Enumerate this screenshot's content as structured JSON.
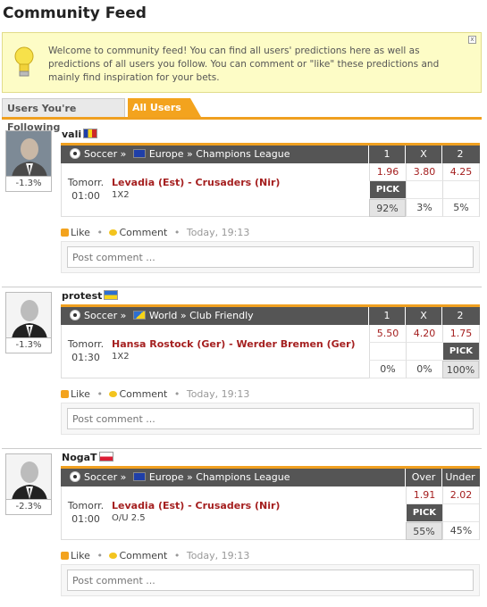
{
  "page": {
    "title": "Community Feed"
  },
  "notice": {
    "text": "Welcome to community feed! You can find all users' predictions here as well as predictions of all users you follow. You can comment or \"like\" these predictions and mainly find inspiration for your bets.",
    "close": "x"
  },
  "tabs": [
    {
      "label": "Users You're Following",
      "active": false
    },
    {
      "label": "All Users",
      "active": true
    }
  ],
  "posts": [
    {
      "user": "vali",
      "flag": "romania",
      "pct": "-1.3%",
      "sport": "Soccer",
      "sep1": "»",
      "region": "Europe",
      "sep2": "»",
      "league": "Champions League",
      "cols": [
        "1",
        "X",
        "2"
      ],
      "time_day": "Tomorr.",
      "time_hour": "01:00",
      "match": "Levadia (Est) - Crusaders (Nir)",
      "market": "1X2",
      "odds": [
        "1.96",
        "3.80",
        "4.25"
      ],
      "pick_index": 0,
      "pick_label": "PICK",
      "shares": [
        "92%",
        "3%",
        "5%"
      ],
      "like": "Like",
      "comment": "Comment",
      "timestamp": "Today, 19:13",
      "placeholder": "Post comment ..."
    },
    {
      "user": "protest",
      "flag": "ukraine",
      "pct": "-1.3%",
      "sport": "Soccer",
      "sep1": "»",
      "region": "World",
      "sep2": "»",
      "league": "Club Friendly",
      "cols": [
        "1",
        "X",
        "2"
      ],
      "time_day": "Tomorr.",
      "time_hour": "01:30",
      "match": "Hansa Rostock (Ger) - Werder Bremen (Ger)",
      "market": "1X2",
      "odds": [
        "5.50",
        "4.20",
        "1.75"
      ],
      "pick_index": 2,
      "pick_label": "PICK",
      "shares": [
        "0%",
        "0%",
        "100%"
      ],
      "like": "Like",
      "comment": "Comment",
      "timestamp": "Today, 19:13",
      "placeholder": "Post comment ..."
    },
    {
      "user": "NogaT",
      "flag": "poland",
      "pct": "-2.3%",
      "sport": "Soccer",
      "sep1": "»",
      "region": "Europe",
      "sep2": "»",
      "league": "Champions League",
      "cols": [
        "Over",
        "Under"
      ],
      "time_day": "Tomorr.",
      "time_hour": "01:00",
      "match": "Levadia (Est) - Crusaders (Nir)",
      "market": "O/U 2.5",
      "odds": [
        "1.91",
        "2.02"
      ],
      "pick_index": 0,
      "pick_label": "PICK",
      "shares": [
        "55%",
        "45%"
      ],
      "like": "Like",
      "comment": "Comment",
      "timestamp": "Today, 19:13",
      "placeholder": "Post comment ..."
    }
  ],
  "colors": {
    "accent": "#f3a31e",
    "header": "#555555",
    "odd": "#a52020"
  }
}
